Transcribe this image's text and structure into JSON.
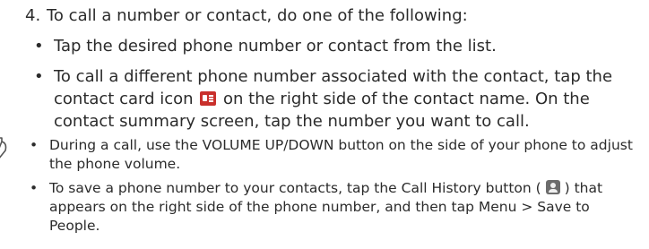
{
  "step": {
    "number": "4.",
    "intro": "To call a number or contact, do one of the following:",
    "bullets": [
      {
        "text": "Tap the desired phone number or contact from the list."
      },
      {
        "before_icon": "To call a different phone number associated with the contact, tap the contact card icon",
        "after_icon": "on the right side of the contact name. On the contact summary screen, tap the number you want to call.",
        "icon": "contact-card-icon"
      }
    ]
  },
  "tips": {
    "icon": "tip-pencil-icon",
    "items": [
      {
        "text": "During a call, use the VOLUME UP/DOWN button on the side of your phone to adjust the phone volume."
      },
      {
        "part1": "To save a phone number to your contacts, tap the",
        "bold1": "Call History",
        "part2": "button (",
        "icon": "call-history-icon",
        "part3": ") that appears on the right side of the phone number, and then tap",
        "bold2": "Menu > Save to People",
        "part4": "."
      }
    ]
  },
  "colors": {
    "text": "#2b2b2b",
    "card_icon": "#c9302c",
    "history_icon": "#6c6c6c"
  }
}
